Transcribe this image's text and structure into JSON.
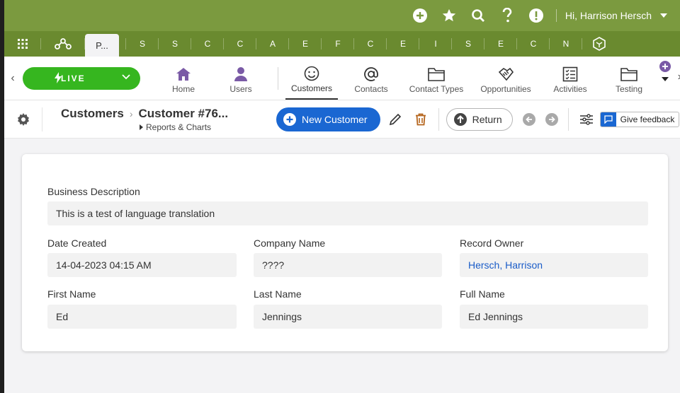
{
  "topbar": {
    "greeting": "Hi, Harrison Hersch",
    "icons": [
      "plus-circle-icon",
      "star-icon",
      "search-icon",
      "help-icon",
      "alert-icon"
    ]
  },
  "tabbar": {
    "active_tab": "P...",
    "tabs": [
      "S",
      "S",
      "C",
      "C",
      "A",
      "E",
      "F",
      "C",
      "E",
      "I",
      "S",
      "E",
      "C",
      "N"
    ]
  },
  "nav": {
    "live_label": "LIVE",
    "items": [
      {
        "label": "Home"
      },
      {
        "label": "Users"
      },
      {
        "label": "Customers"
      },
      {
        "label": "Contacts"
      },
      {
        "label": "Contact Types"
      },
      {
        "label": "Opportunities"
      },
      {
        "label": "Activities"
      },
      {
        "label": "Testing"
      }
    ]
  },
  "header": {
    "crumb_root": "Customers",
    "crumb_current": "Customer #76...",
    "sub_link": "Reports & Charts",
    "new_button": "New Customer",
    "return_button": "Return",
    "feedback_button": "Give feedback"
  },
  "record": {
    "business_description": {
      "label": "Business Description",
      "value": "This is a test of language translation"
    },
    "date_created": {
      "label": "Date Created",
      "value": "14-04-2023 04:15 AM"
    },
    "company_name": {
      "label": "Company Name",
      "value": "????"
    },
    "record_owner": {
      "label": "Record Owner",
      "value": "Hersch, Harrison"
    },
    "first_name": {
      "label": "First Name",
      "value": "Ed"
    },
    "last_name": {
      "label": "Last Name",
      "value": "Jennings"
    },
    "full_name": {
      "label": "Full Name",
      "value": "Ed Jennings"
    }
  },
  "colors": {
    "topbar": "#7b9a3f",
    "tabbar": "#6a8a2f",
    "live": "#36b61f",
    "primary": "#1a67d2",
    "nav_icon": "#7a5aa6"
  }
}
